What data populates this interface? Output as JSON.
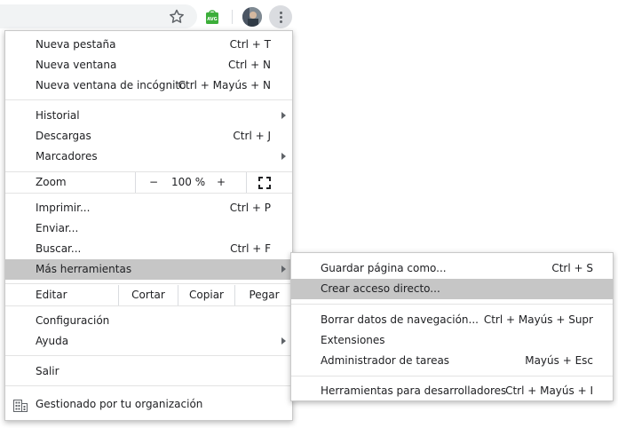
{
  "toolbar": {
    "icons": [
      "star-icon",
      "avg-extension-icon",
      "profile-avatar",
      "more-menu-icon"
    ],
    "avg_label": "AVG"
  },
  "menu": {
    "items": [
      {
        "label": "Nueva pestaña",
        "shortcut": "Ctrl + T"
      },
      {
        "label": "Nueva ventana",
        "shortcut": "Ctrl + N"
      },
      {
        "label": "Nueva ventana de incógnito",
        "shortcut": "Ctrl + Mayús + N"
      },
      {
        "label": "Historial",
        "submenu": true
      },
      {
        "label": "Descargas",
        "shortcut": "Ctrl + J"
      },
      {
        "label": "Marcadores",
        "submenu": true
      }
    ],
    "zoom": {
      "label": "Zoom",
      "minus": "−",
      "value": "100 %",
      "plus": "+"
    },
    "items2": [
      {
        "label": "Imprimir...",
        "shortcut": "Ctrl + P"
      },
      {
        "label": "Enviar..."
      },
      {
        "label": "Buscar...",
        "shortcut": "Ctrl + F"
      },
      {
        "label": "Más herramientas",
        "submenu": true,
        "highlighted": true
      }
    ],
    "edit": {
      "label": "Editar",
      "cut": "Cortar",
      "copy": "Copiar",
      "paste": "Pegar"
    },
    "items3": [
      {
        "label": "Configuración"
      },
      {
        "label": "Ayuda",
        "submenu": true
      }
    ],
    "exit": {
      "label": "Salir"
    },
    "managed": {
      "label": "Gestionado por tu organización"
    }
  },
  "submenu": {
    "items": [
      {
        "label": "Guardar página como...",
        "shortcut": "Ctrl + S"
      },
      {
        "label": "Crear acceso directo...",
        "highlighted": true
      },
      {
        "label": "Borrar datos de navegación...",
        "shortcut": "Ctrl + Mayús + Supr"
      },
      {
        "label": "Extensiones"
      },
      {
        "label": "Administrador de tareas",
        "shortcut": "Mayús + Esc"
      },
      {
        "label": "Herramientas para desarrolladores",
        "shortcut": "Ctrl + Mayús + I"
      }
    ]
  },
  "colors": {
    "highlight": "#c6c6c6",
    "avg_green": "#3cae3a",
    "kebab_bg": "#dadce0"
  }
}
